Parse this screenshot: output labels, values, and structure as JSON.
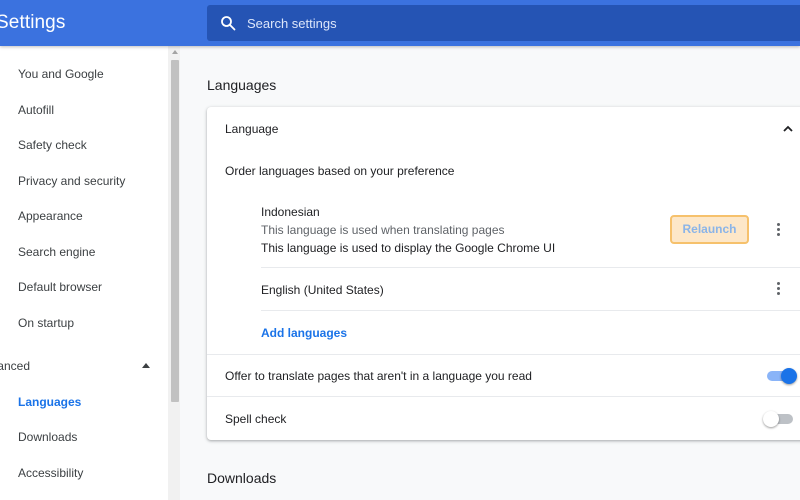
{
  "header": {
    "title": "Settings",
    "search_placeholder": "Search settings"
  },
  "sidebar": {
    "items": [
      {
        "label": "You and Google"
      },
      {
        "label": "Autofill"
      },
      {
        "label": "Safety check"
      },
      {
        "label": "Privacy and security"
      },
      {
        "label": "Appearance"
      },
      {
        "label": "Search engine"
      },
      {
        "label": "Default browser"
      },
      {
        "label": "On startup"
      }
    ],
    "advanced_label": "Advanced",
    "advanced_items": [
      {
        "label": "Languages",
        "active": true
      },
      {
        "label": "Downloads"
      },
      {
        "label": "Accessibility"
      }
    ]
  },
  "main": {
    "languages_title": "Languages",
    "language_card": {
      "header": "Language",
      "order_text": "Order languages based on your preference",
      "languages": [
        {
          "name": "Indonesian",
          "note1": "This language is used when translating pages",
          "note2": "This language is used to display the Google Chrome UI",
          "button": "Relaunch"
        },
        {
          "name": "English (United States)"
        }
      ],
      "add_languages": "Add languages",
      "offer_translate": {
        "label": "Offer to translate pages that aren't in a language you read",
        "enabled": true
      },
      "spell_check": {
        "label": "Spell check",
        "enabled": false
      }
    },
    "downloads_title": "Downloads"
  },
  "colors": {
    "header": "#3b72df",
    "search_box": "#2554b4",
    "accent": "#1a73e8",
    "relaunch_bg": "#fde7c8",
    "relaunch_border": "#f6c16c"
  }
}
